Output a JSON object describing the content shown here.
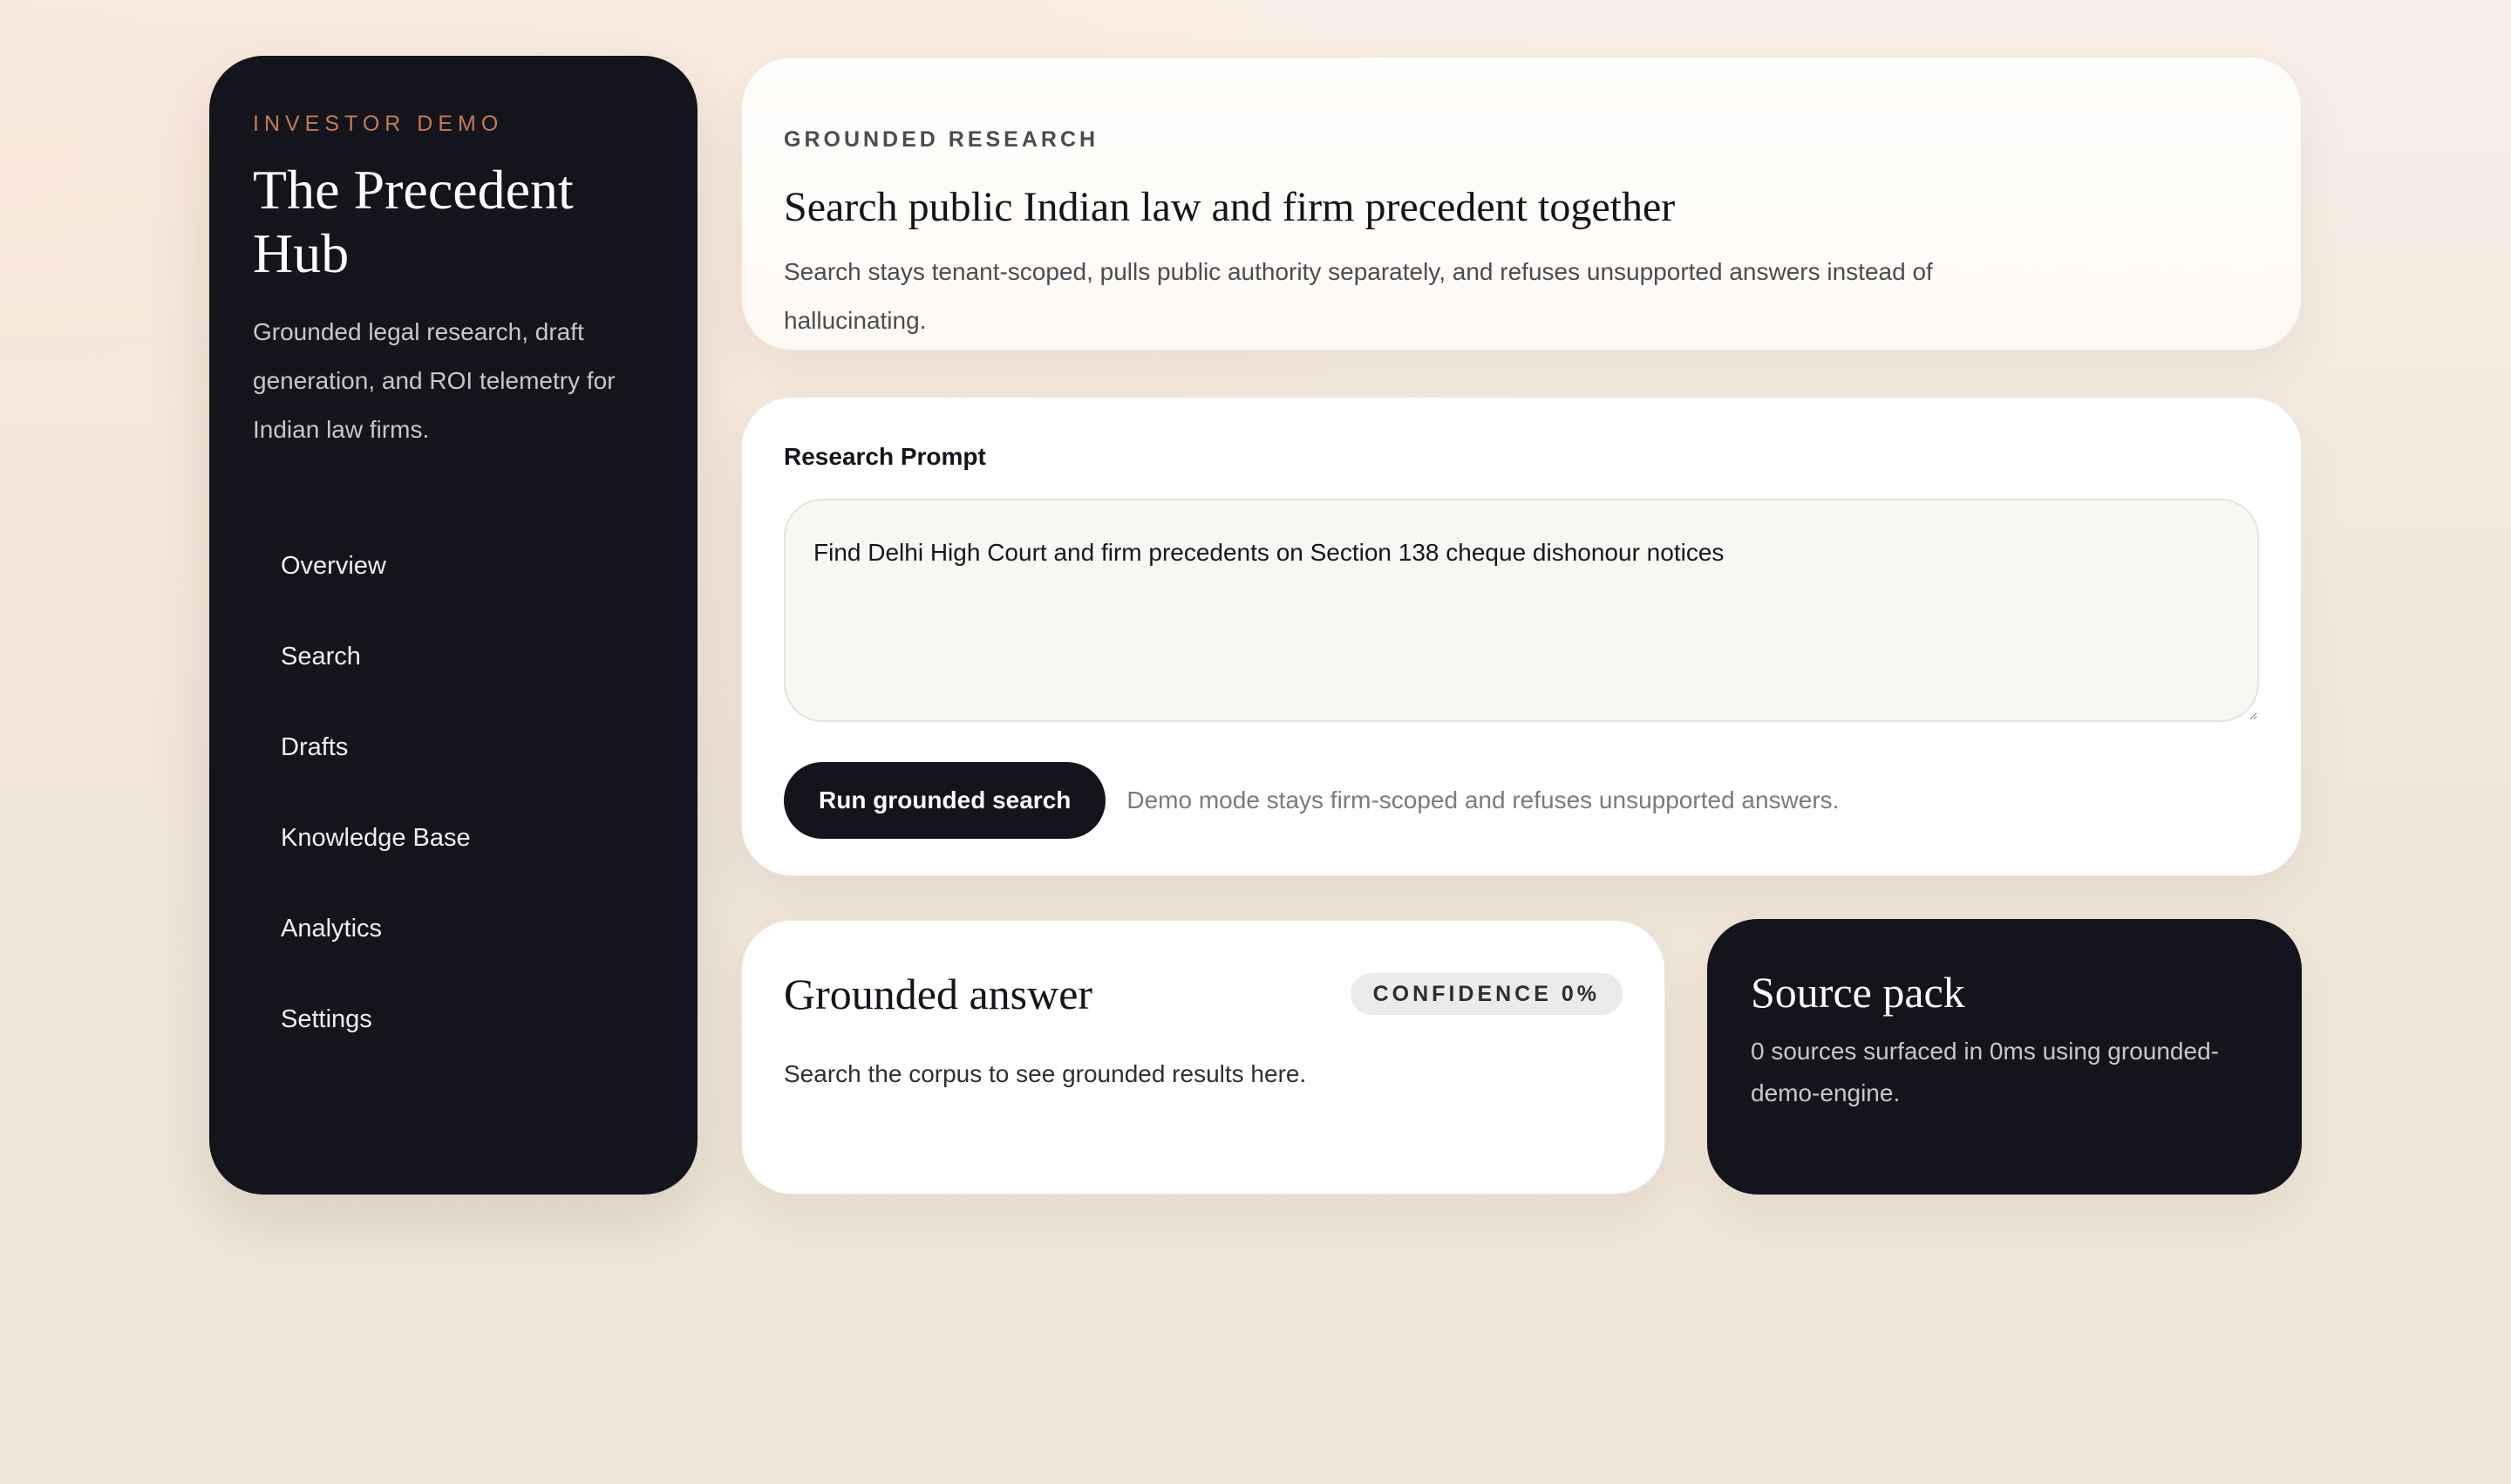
{
  "sidebar": {
    "eyebrow": "INVESTOR DEMO",
    "title": "The Precedent Hub",
    "description": "Grounded legal research, draft generation, and ROI telemetry for Indian law firms.",
    "nav": [
      {
        "label": "Overview"
      },
      {
        "label": "Search"
      },
      {
        "label": "Drafts"
      },
      {
        "label": "Knowledge Base"
      },
      {
        "label": "Analytics"
      },
      {
        "label": "Settings"
      }
    ]
  },
  "hero": {
    "eyebrow": "GROUNDED RESEARCH",
    "title": "Search public Indian law and firm precedent together",
    "description": "Search stays tenant-scoped, pulls public authority separately, and refuses unsupported answers instead of hallucinating."
  },
  "prompt": {
    "label": "Research Prompt",
    "value": "Find Delhi High Court and firm precedents on Section 138 cheque dishonour notices",
    "button": "Run grounded search",
    "hint": "Demo mode stays firm-scoped and refuses unsupported answers."
  },
  "answer": {
    "title": "Grounded answer",
    "confidence_badge": "CONFIDENCE 0%",
    "confidence": 0,
    "body": "Search the corpus to see grounded results here."
  },
  "source_pack": {
    "title": "Source pack",
    "summary": "0 sources surfaced in 0ms using grounded-demo-engine."
  },
  "colors": {
    "sidebar_bg": "#13141c",
    "accent": "#c77a52",
    "page_bg": "#efe6d9",
    "card_bg": "#ffffff"
  }
}
